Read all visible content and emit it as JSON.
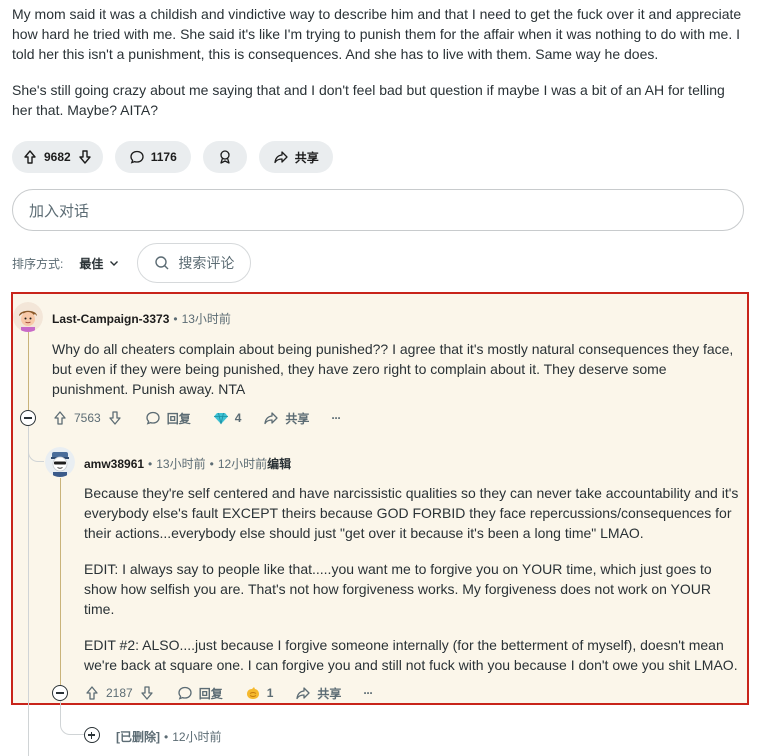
{
  "post": {
    "paragraph_1": "My mom said it was a childish and vindictive way to describe him and that I need to get the fuck over it and appreciate how hard he tried with me. She said it's like I'm trying to punish them for the affair when it was nothing to do with me. I told her this isn't a punishment, this is consequences. And she has to live with them. Same way he does.",
    "paragraph_2": "She's still going crazy about me saying that and I don't feel bad but question if maybe I was a bit of an AH for telling her that. Maybe? AITA?",
    "vote_count": "9682",
    "comment_count": "1176",
    "share_label": "共享"
  },
  "add_comment": {
    "placeholder": "加入对话"
  },
  "sort": {
    "label": "排序方式:",
    "value": "最佳",
    "search_label": "搜索评论"
  },
  "comments": [
    {
      "author": "Last-Campaign-3373",
      "separator": "•",
      "time": "13小时前",
      "body": [
        "Why do all cheaters complain about being punished?? I agree that it's mostly natural consequences they face, but even if they were being punished, they have zero right to complain about it. They deserve some punishment. Punish away. NTA"
      ],
      "votes": "7563",
      "reply_label": "回复",
      "award_count": "4",
      "share_label": "共享",
      "more_label": "···"
    },
    {
      "author": "amw38961",
      "separator": "•",
      "time": "13小时前",
      "separator2": "•",
      "edited_time": "12小时前",
      "edited_label": "编辑",
      "body": [
        "Because they're self centered and have narcissistic qualities so they can never take accountability and it's everybody else's fault EXCEPT theirs because GOD FORBID they face repercussions/consequences for their actions...everybody else should just \"get over it because it's been a long time\" LMAO.",
        "EDIT: I always say to people like that.....you want me to forgive you on YOUR time, which just goes to show how selfish you are. That's not how forgiveness works. My forgiveness does not work on YOUR time.",
        "EDIT #2: ALSO....just because I forgive someone internally (for the betterment of myself), doesn't mean we're back at square one. I can forgive you and still not fuck with you because I don't owe you shit LMAO."
      ],
      "votes": "2187",
      "reply_label": "回复",
      "award_count": "1",
      "share_label": "共享",
      "more_label": "···"
    },
    {
      "author": "[已删除]",
      "separator": "•",
      "time": "12小时前"
    }
  ]
}
